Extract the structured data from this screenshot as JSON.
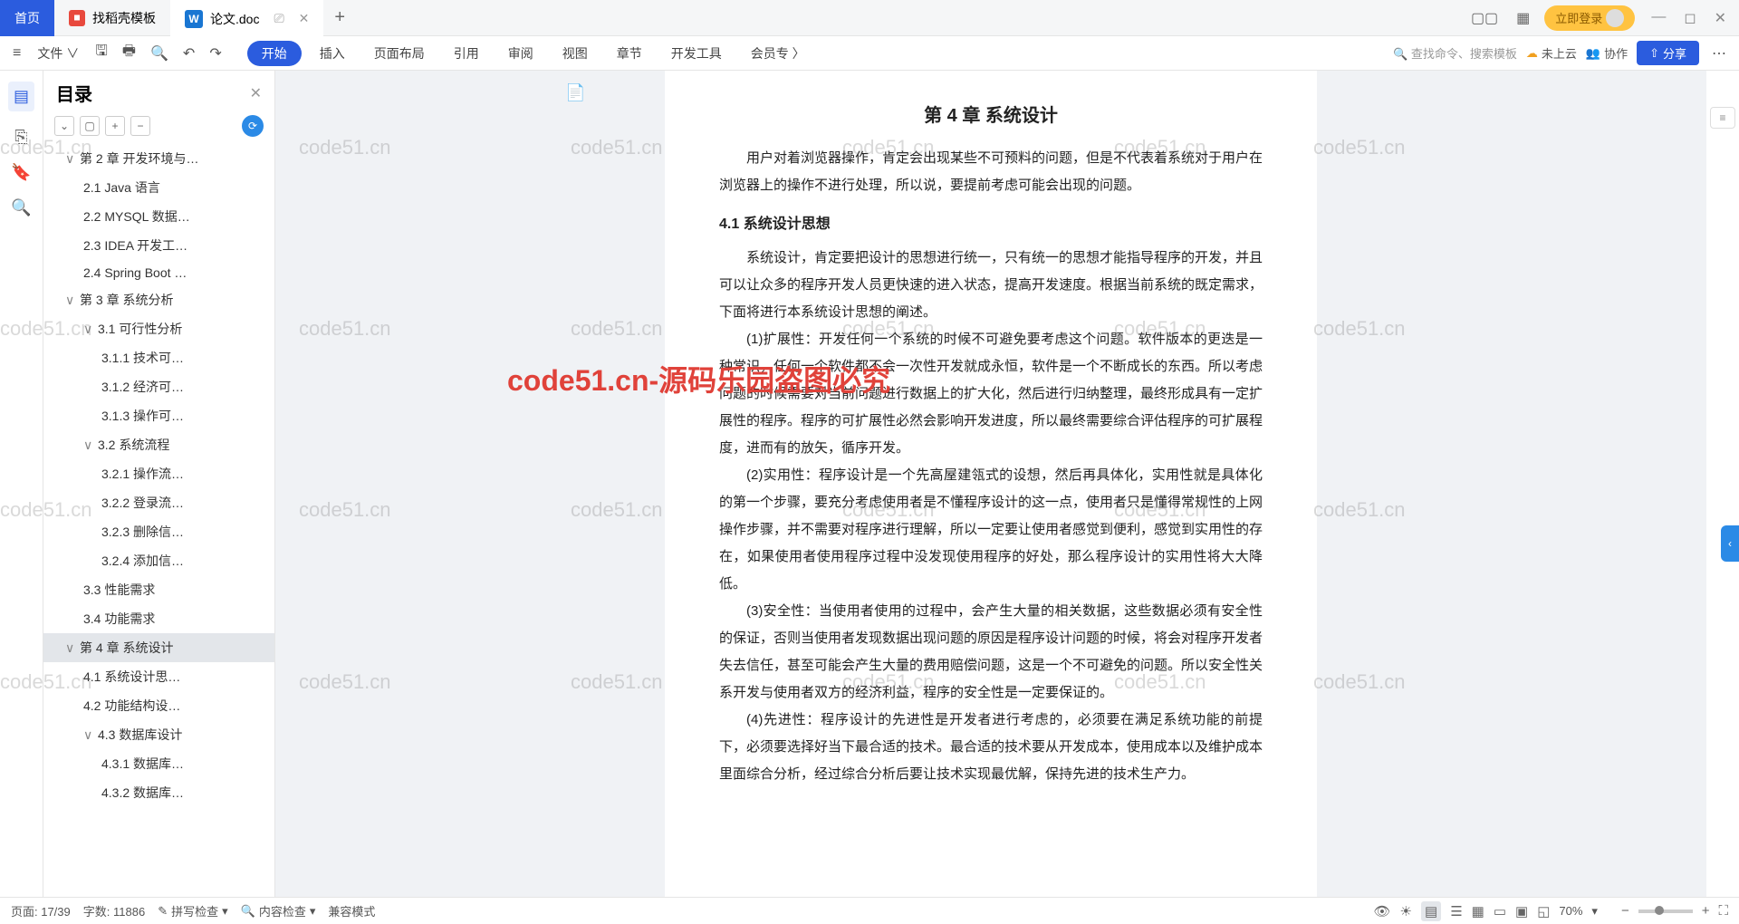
{
  "titlebar": {
    "home": "首页",
    "tab1": "找稻壳模板",
    "tab2": "论文.doc",
    "login": "立即登录"
  },
  "ribbon": {
    "file": "文件",
    "tabs": [
      "开始",
      "插入",
      "页面布局",
      "引用",
      "审阅",
      "视图",
      "章节",
      "开发工具",
      "会员专"
    ],
    "search_ph": "查找命令、搜索模板",
    "cloud": "未上云",
    "collab": "协作",
    "share": "分享"
  },
  "outline": {
    "title": "目录",
    "items": [
      {
        "lvl": 1,
        "chev": "∨",
        "text": "第 2 章  开发环境与…"
      },
      {
        "lvl": 2,
        "chev": "",
        "text": "2.1 Java 语言"
      },
      {
        "lvl": 2,
        "chev": "",
        "text": "2.2 MYSQL 数据…"
      },
      {
        "lvl": 2,
        "chev": "",
        "text": "2.3 IDEA 开发工…"
      },
      {
        "lvl": 2,
        "chev": "",
        "text": "2.4 Spring Boot …"
      },
      {
        "lvl": 1,
        "chev": "∨",
        "text": "第 3 章  系统分析"
      },
      {
        "lvl": 2,
        "chev": "∨",
        "text": "3.1 可行性分析"
      },
      {
        "lvl": 3,
        "chev": "",
        "text": "3.1.1 技术可…"
      },
      {
        "lvl": 3,
        "chev": "",
        "text": "3.1.2 经济可…"
      },
      {
        "lvl": 3,
        "chev": "",
        "text": "3.1.3 操作可…"
      },
      {
        "lvl": 2,
        "chev": "∨",
        "text": "3.2 系统流程"
      },
      {
        "lvl": 3,
        "chev": "",
        "text": "3.2.1 操作流…"
      },
      {
        "lvl": 3,
        "chev": "",
        "text": "3.2.2 登录流…"
      },
      {
        "lvl": 3,
        "chev": "",
        "text": "3.2.3 删除信…"
      },
      {
        "lvl": 3,
        "chev": "",
        "text": "3.2.4 添加信…"
      },
      {
        "lvl": 2,
        "chev": "",
        "text": "3.3 性能需求"
      },
      {
        "lvl": 2,
        "chev": "",
        "text": "3.4 功能需求"
      },
      {
        "lvl": 1,
        "chev": "∨",
        "text": "第 4 章  系统设计",
        "sel": true
      },
      {
        "lvl": 2,
        "chev": "",
        "text": "4.1 系统设计思…"
      },
      {
        "lvl": 2,
        "chev": "",
        "text": "4.2 功能结构设…"
      },
      {
        "lvl": 2,
        "chev": "∨",
        "text": "4.3 数据库设计"
      },
      {
        "lvl": 3,
        "chev": "",
        "text": "4.3.1 数据库…"
      },
      {
        "lvl": 3,
        "chev": "",
        "text": "4.3.2 数据库…"
      }
    ]
  },
  "doc": {
    "chapter": "第 4 章  系统设计",
    "p1": "用户对着浏览器操作，肯定会出现某些不可预料的问题，但是不代表着系统对于用户在浏览器上的操作不进行处理，所以说，要提前考虑可能会出现的问题。",
    "s41": "4.1  系统设计思想",
    "p2": "系统设计，肯定要把设计的思想进行统一，只有统一的思想才能指导程序的开发，并且可以让众多的程序开发人员更快速的进入状态，提高开发速度。根据当前系统的既定需求，下面将进行本系统设计思想的阐述。",
    "p3": "(1)扩展性：开发任何一个系统的时候不可避免要考虑这个问题。软件版本的更迭是一种常识，任何一个软件都不会一次性开发就成永恒，软件是一个不断成长的东西。所以考虑问题的时候需要对当前问题进行数据上的扩大化，然后进行归纳整理，最终形成具有一定扩展性的程序。程序的可扩展性必然会影响开发进度，所以最终需要综合评估程序的可扩展程度，进而有的放矢，循序开发。",
    "p4": "(2)实用性：程序设计是一个先高屋建瓴式的设想，然后再具体化，实用性就是具体化的第一个步骤，要充分考虑使用者是不懂程序设计的这一点，使用者只是懂得常规性的上网操作步骤，并不需要对程序进行理解，所以一定要让使用者感觉到便利，感觉到实用性的存在，如果使用者使用程序过程中没发现使用程序的好处，那么程序设计的实用性将大大降低。",
    "p5": "(3)安全性：当使用者使用的过程中，会产生大量的相关数据，这些数据必须有安全性的保证，否则当使用者发现数据出现问题的原因是程序设计问题的时候，将会对程序开发者失去信任，甚至可能会产生大量的费用赔偿问题，这是一个不可避免的问题。所以安全性关系开发与使用者双方的经济利益，程序的安全性是一定要保证的。",
    "p6": "(4)先进性：程序设计的先进性是开发者进行考虑的，必须要在满足系统功能的前提下，必须要选择好当下最合适的技术。最合适的技术要从开发成本，使用成本以及维护成本里面综合分析，经过综合分析后要让技术实现最优解，保持先进的技术生产力。"
  },
  "overlay": "code51.cn-源码乐园盗图必究",
  "wm": "code51.cn",
  "status": {
    "page": "页面: 17/39",
    "words": "字数: 11886",
    "spell": "拼写检查",
    "content": "内容检查",
    "compat": "兼容模式",
    "zoom": "70%"
  }
}
